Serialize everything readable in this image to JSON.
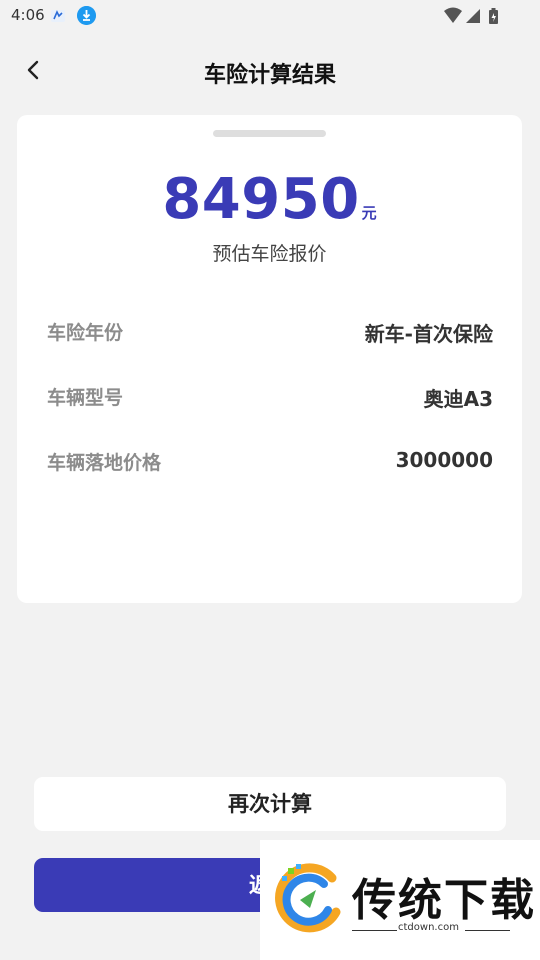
{
  "status_bar": {
    "time": "4:06"
  },
  "header": {
    "title": "车险计算结果",
    "back_icon": "chevron-left-icon"
  },
  "result": {
    "price": "84950",
    "unit": "元",
    "caption": "预估车险报价",
    "accent_color": "#3a3bb6"
  },
  "details": [
    {
      "label": "车险年份",
      "value": "新车-首次保险"
    },
    {
      "label": "车辆型号",
      "value": "奥迪A3"
    },
    {
      "label": "车辆落地价格",
      "value": "3000000"
    }
  ],
  "actions": {
    "recalculate_label": "再次计算",
    "return_label": "返回"
  },
  "watermark": {
    "brand": "传统下载",
    "site": "ctdown.com"
  }
}
